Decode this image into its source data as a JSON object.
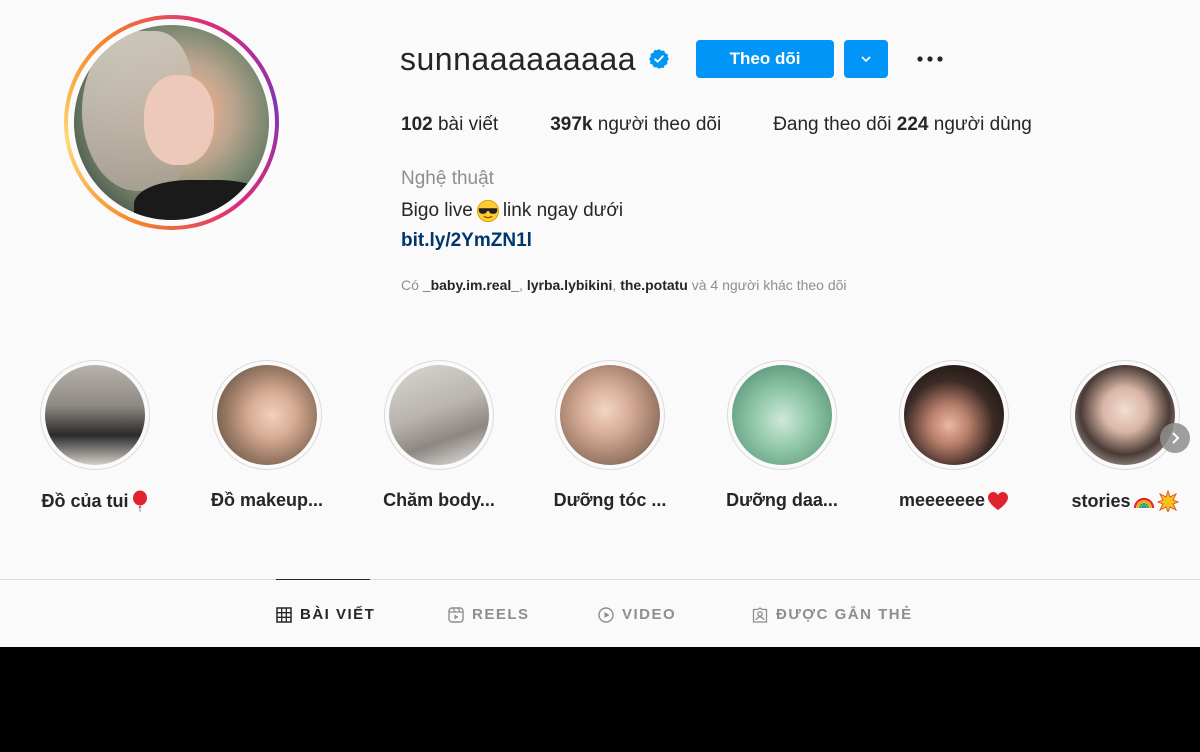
{
  "profile": {
    "username": "sunnaaaaaaaaa",
    "follow_label": "Theo dõi",
    "stats": {
      "posts_count": "102",
      "posts_label": " bài viết",
      "followers_count": "397k",
      "followers_label": " người theo dõi",
      "following_prefix": "Đang theo dõi ",
      "following_count": "224",
      "following_suffix": " người dùng"
    },
    "category": "Nghệ thuật",
    "bio_before": "Bigo live",
    "bio_emoji": "smiling-face-with-sunglasses",
    "bio_after": " link ngay dưới",
    "link": "bit.ly/2YmZN1l",
    "followed_by": {
      "prefix": "Có ",
      "user1": "_baby.im.real_",
      "sep1": ", ",
      "user2": "lyrba.lybikini",
      "sep2": ", ",
      "user3": "the.potatu",
      "suffix": " và 4 người khác theo dõi"
    }
  },
  "highlights": [
    {
      "label": "Đồ của tui",
      "emoji": "balloon"
    },
    {
      "label": "Đồ makeup...",
      "emoji": ""
    },
    {
      "label": "Chăm body...",
      "emoji": ""
    },
    {
      "label": "Dưỡng tóc ...",
      "emoji": ""
    },
    {
      "label": "Dưỡng daa...",
      "emoji": ""
    },
    {
      "label": "meeeeeee",
      "emoji": "red-heart"
    },
    {
      "label": "stories",
      "emoji": "rainbow collision"
    }
  ],
  "tabs": [
    {
      "label": "BÀI VIẾT",
      "icon": "grid-icon",
      "active": true
    },
    {
      "label": "REELS",
      "icon": "reels-icon",
      "active": false
    },
    {
      "label": "VIDEO",
      "icon": "play-icon",
      "active": false
    },
    {
      "label": "ĐƯỢC GẮN THẺ",
      "icon": "tagged-icon",
      "active": false
    }
  ],
  "colors": {
    "accent": "#0095f6",
    "link": "#00376b",
    "muted": "#8e8e8e",
    "text": "#262626",
    "background": "#fafafa"
  }
}
